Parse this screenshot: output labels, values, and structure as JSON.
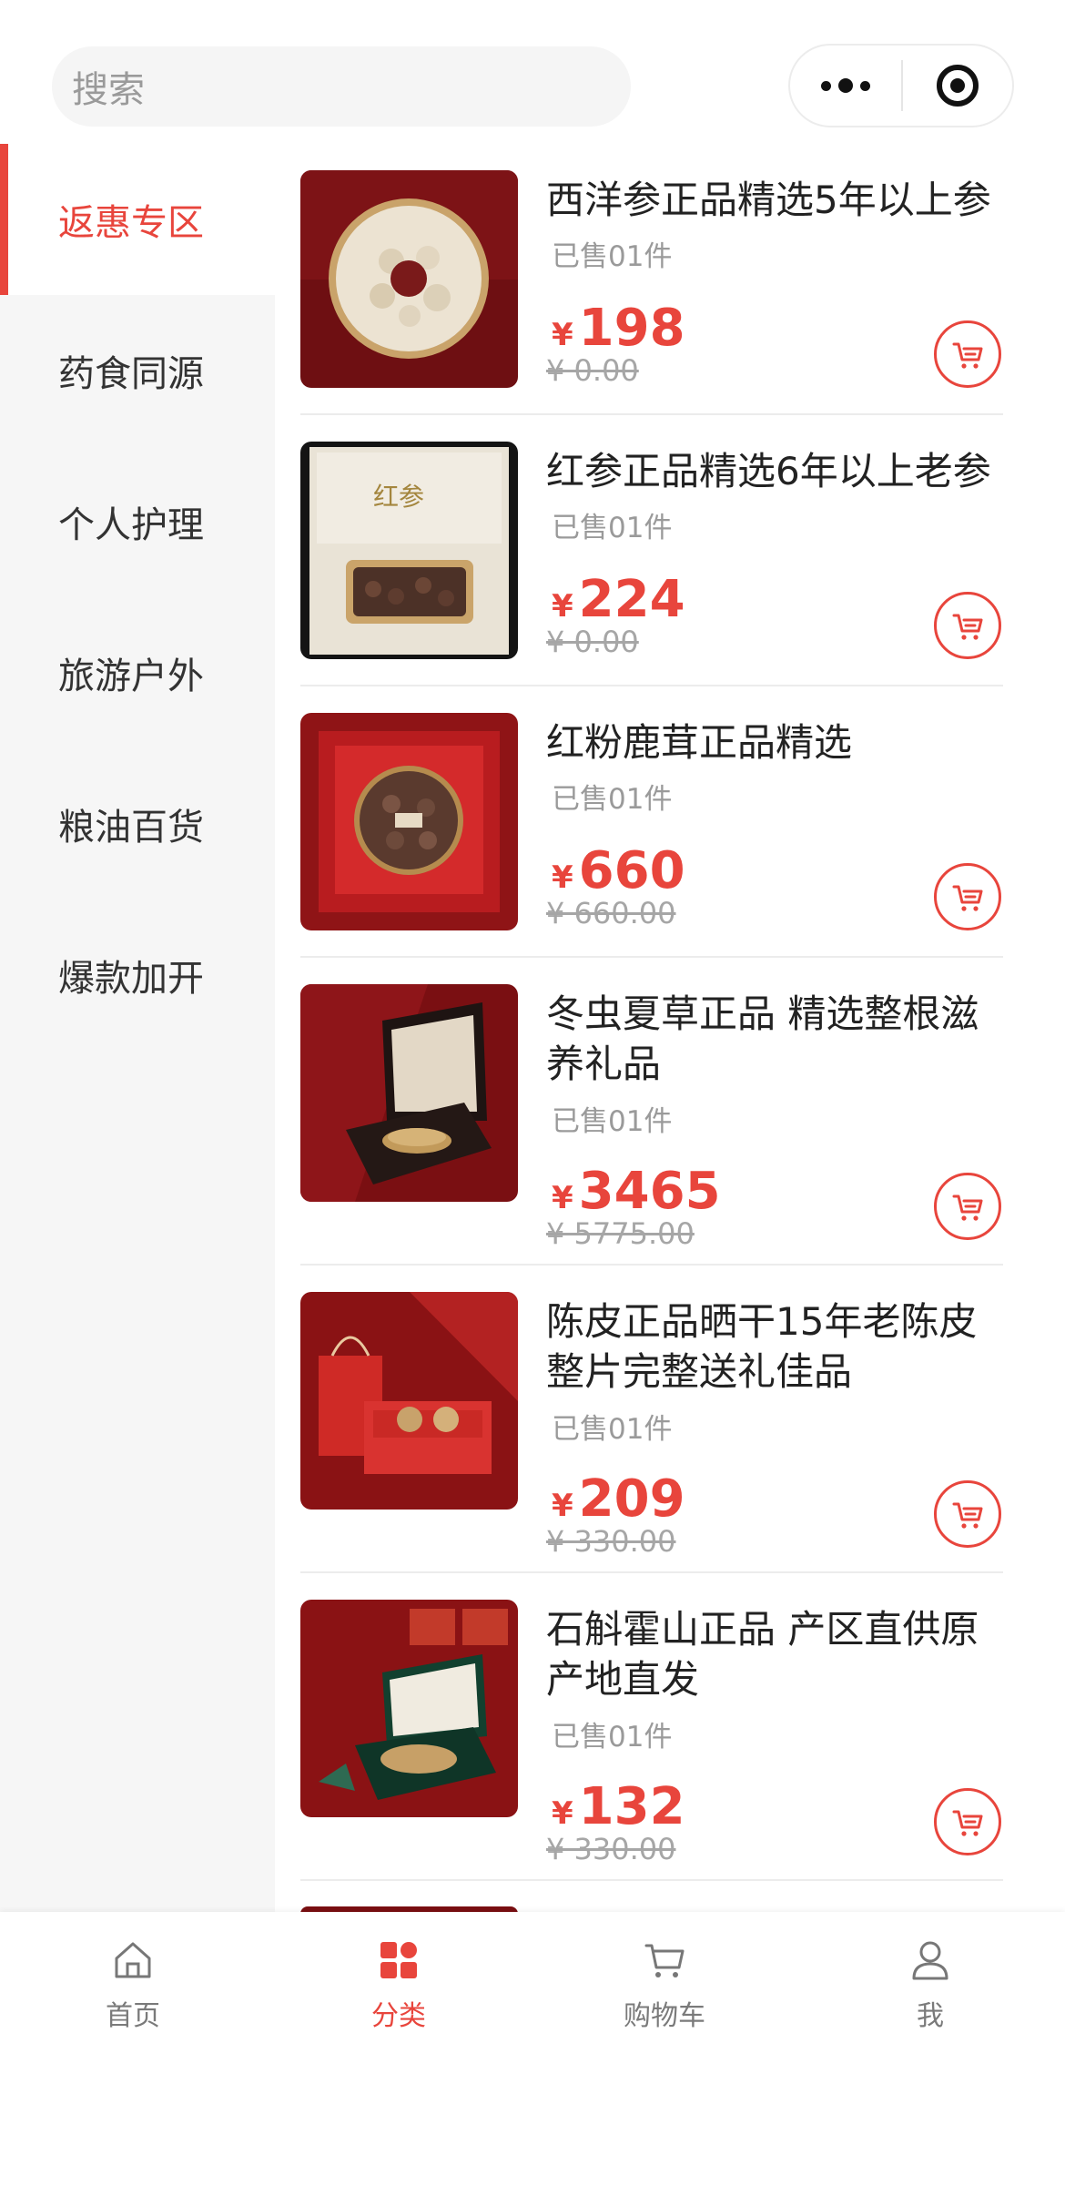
{
  "header": {
    "search_placeholder": "搜索",
    "more_icon": "more-dots-icon",
    "close_icon": "target-close-icon"
  },
  "sidebar": {
    "items": [
      {
        "label": "返惠专区",
        "active": true
      },
      {
        "label": "药食同源",
        "active": false
      },
      {
        "label": "个人护理",
        "active": false
      },
      {
        "label": "旅游户外",
        "active": false
      },
      {
        "label": "粮油百货",
        "active": false
      },
      {
        "label": "爆款加开",
        "active": false
      }
    ]
  },
  "products": [
    {
      "name": "西洋参正品精选5年以上参",
      "sold": "已售01件",
      "currency": "¥",
      "price": "198",
      "original": "¥ 0.00"
    },
    {
      "name": "红参正品精选6年以上老参",
      "sold": "已售01件",
      "currency": "¥",
      "price": "224",
      "original": "¥ 0.00"
    },
    {
      "name": "红粉鹿茸正品精选",
      "sold": "已售01件",
      "currency": "¥",
      "price": "660",
      "original": "¥ 660.00"
    },
    {
      "name": "冬虫夏草正品 精选整根滋养礼品",
      "sold": "已售01件",
      "currency": "¥",
      "price": "3465",
      "original": "¥ 5775.00"
    },
    {
      "name": "陈皮正品晒干15年老陈皮整片完整送礼佳品",
      "sold": "已售01件",
      "currency": "¥",
      "price": "209",
      "original": "¥ 330.00"
    },
    {
      "name": "石斛霍山正品 产区直供原产地直发",
      "sold": "已售01件",
      "currency": "¥",
      "price": "132",
      "original": "¥ 330.00"
    }
  ],
  "tabbar": {
    "tabs": [
      {
        "label": "首页",
        "icon": "home-icon",
        "active": false
      },
      {
        "label": "分类",
        "icon": "category-icon",
        "active": true
      },
      {
        "label": "购物车",
        "icon": "cart-icon",
        "active": false
      },
      {
        "label": "我",
        "icon": "user-icon",
        "active": false
      }
    ]
  },
  "colors": {
    "accent": "#e8453c",
    "sidebar_bg": "#f6f6f6",
    "muted": "#9a9a9a"
  }
}
